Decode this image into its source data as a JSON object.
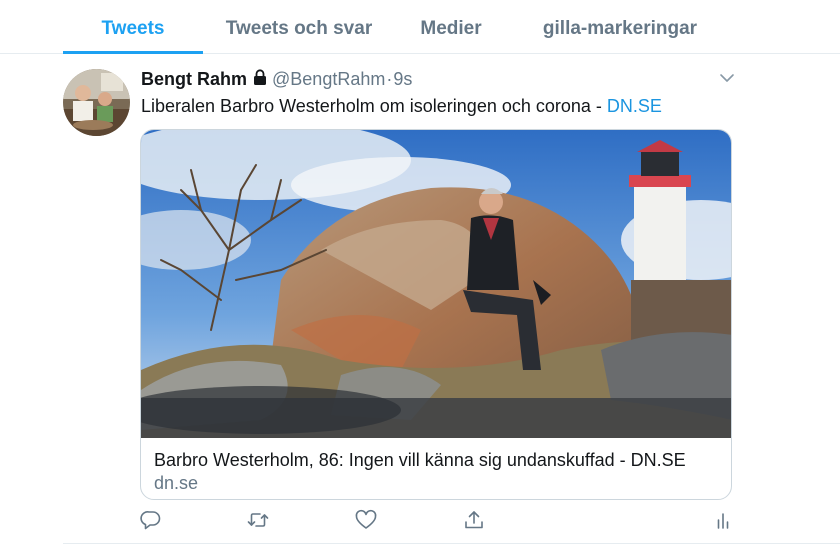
{
  "tabs": [
    {
      "label": "Tweets",
      "active": true
    },
    {
      "label": "Tweets och svar",
      "active": false
    },
    {
      "label": "Medier",
      "active": false
    },
    {
      "label": "gilla-markeringar",
      "active": false
    }
  ],
  "tweet": {
    "author_name": "Bengt Rahm",
    "handle": "@BengtRahm",
    "separator": "·",
    "time": "9s",
    "text": "Liberalen Barbro Westerholm om isoleringen och corona - ",
    "link_text": "DN.SE",
    "card": {
      "title": "Barbro Westerholm, 86: Ingen vill känna sig undanskuffad - DN.SE",
      "domain": "dn.se"
    },
    "icons": {
      "lock": "lock-icon",
      "menu": "chevron-down-icon",
      "reply": "reply-icon",
      "retweet": "retweet-icon",
      "like": "heart-icon",
      "share": "share-icon",
      "analytics": "analytics-icon"
    }
  },
  "colors": {
    "accent": "#1da1f2",
    "link": "#1b95e0",
    "muted": "#657786",
    "text": "#14171a",
    "border": "#e6ecf0"
  }
}
